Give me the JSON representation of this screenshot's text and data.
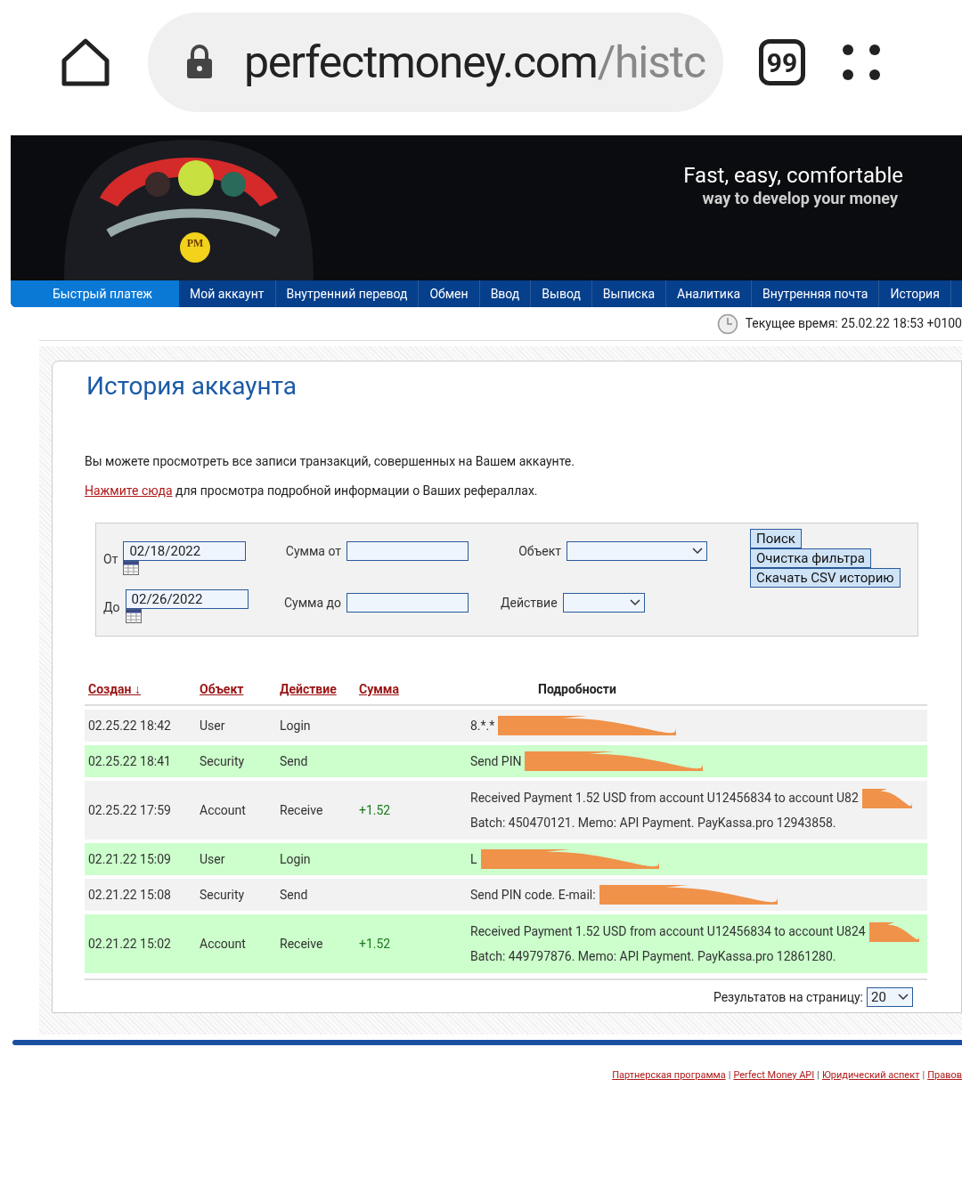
{
  "browser": {
    "url_host": "perfectmoney.com",
    "url_path": "/histc",
    "tab_count": "99"
  },
  "banner": {
    "slogan": "Fast, easy, comfortable",
    "subslogan": "way to develop your money",
    "logo": "PM"
  },
  "nav": [
    {
      "label": "Быстрый платеж",
      "selected": true
    },
    {
      "label": "Мой аккаунт",
      "selected": false
    },
    {
      "label": "Внутренний перевод",
      "selected": false
    },
    {
      "label": "Обмен",
      "selected": false
    },
    {
      "label": "Ввод",
      "selected": false
    },
    {
      "label": "Вывод",
      "selected": false
    },
    {
      "label": "Выписка",
      "selected": false
    },
    {
      "label": "Аналитика",
      "selected": false
    },
    {
      "label": "Внутренняя почта",
      "selected": false
    },
    {
      "label": "История",
      "selected": false
    }
  ],
  "current_time": "Текущее время: 25.02.22 18:53 +0100",
  "page_title": "История аккаунта",
  "intro": "Вы можете просмотреть все записи транзакций, совершенных на Вашем аккаунте.",
  "referral_link": "Нажмите сюда",
  "referral_text": "для просмотра подробной информации о Ваших рефераллах.",
  "filter": {
    "from_label": "От",
    "from_value": "02/18/2022",
    "to_label": "До",
    "to_value": "02/26/2022",
    "sum_from_label": "Сумма от",
    "sum_to_label": "Сумма до",
    "object_label": "Объект",
    "action_label": "Действие",
    "buttons": [
      "Поиск",
      "Очистка фильтра",
      "Скачать CSV историю"
    ]
  },
  "table": {
    "columns": [
      {
        "label": "Создан ↓",
        "kind": "link"
      },
      {
        "label": "Объект",
        "kind": "link"
      },
      {
        "label": "Действие",
        "kind": "link"
      },
      {
        "label": "Сумма",
        "kind": "link"
      },
      {
        "label": "Подробности",
        "kind": "plain"
      }
    ],
    "rows": [
      {
        "created": "02.25.22 18:42",
        "object": "User",
        "action": "Login",
        "amount": "",
        "details": [
          "8.*.*"
        ],
        "highlighted": false,
        "redacted": true
      },
      {
        "created": "02.25.22 18:41",
        "object": "Security",
        "action": "Send",
        "amount": "",
        "details": [
          "Send PIN"
        ],
        "highlighted": true,
        "redacted": true
      },
      {
        "created": "02.25.22 17:59",
        "object": "Account",
        "action": "Receive",
        "amount": "+1.52",
        "details": [
          "Received Payment 1.52 USD from account U12456834 to account U82",
          "Batch: 450470121. Memo: API Payment. PayKassa.pro 12943858."
        ],
        "highlighted": false,
        "redacted": true
      },
      {
        "created": "02.21.22 15:09",
        "object": "User",
        "action": "Login",
        "amount": "",
        "details": [
          "L"
        ],
        "highlighted": true,
        "redacted": true
      },
      {
        "created": "02.21.22 15:08",
        "object": "Security",
        "action": "Send",
        "amount": "",
        "details": [
          "Send PIN code. E-mail:"
        ],
        "highlighted": false,
        "redacted": true
      },
      {
        "created": "02.21.22 15:02",
        "object": "Account",
        "action": "Receive",
        "amount": "+1.52",
        "details": [
          "Received Payment 1.52 USD from account U12456834 to account U824",
          "Batch: 449797876. Memo: API Payment. PayKassa.pro 12861280."
        ],
        "highlighted": true,
        "redacted": true
      }
    ]
  },
  "per_page_label": "Результатов на страницу:",
  "per_page_value": "20",
  "footer_separator": "|",
  "footer_links": [
    "Партнерская программа",
    "Perfect Money API",
    "Юридический аспект",
    "Правов"
  ]
}
